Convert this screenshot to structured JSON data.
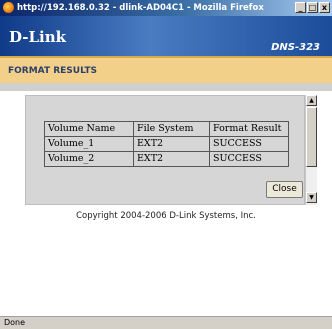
{
  "window": {
    "title": "http://192.168.0.32 - dlink-AD04C1 - Mozilla Firefox",
    "buttons": {
      "minimize": "_",
      "maximize": "□",
      "close": "x"
    }
  },
  "brand": {
    "logo": "D-Link",
    "model": "DNS-323"
  },
  "section": {
    "title": "FORMAT RESULTS"
  },
  "results": {
    "headers": [
      "Volume Name",
      "File System",
      "Format Result"
    ],
    "rows": [
      [
        "Volume_1",
        "EXT2",
        "SUCCESS"
      ],
      [
        "Volume_2",
        "EXT2",
        "SUCCESS"
      ]
    ],
    "close_label": "Close"
  },
  "footer": {
    "copyright": "Copyright 2004-2006 D-Link Systems, Inc."
  },
  "status": {
    "text": "Done"
  },
  "icons": {
    "browser": "firefox-icon",
    "scroll_up": "▲",
    "scroll_down": "▼"
  }
}
